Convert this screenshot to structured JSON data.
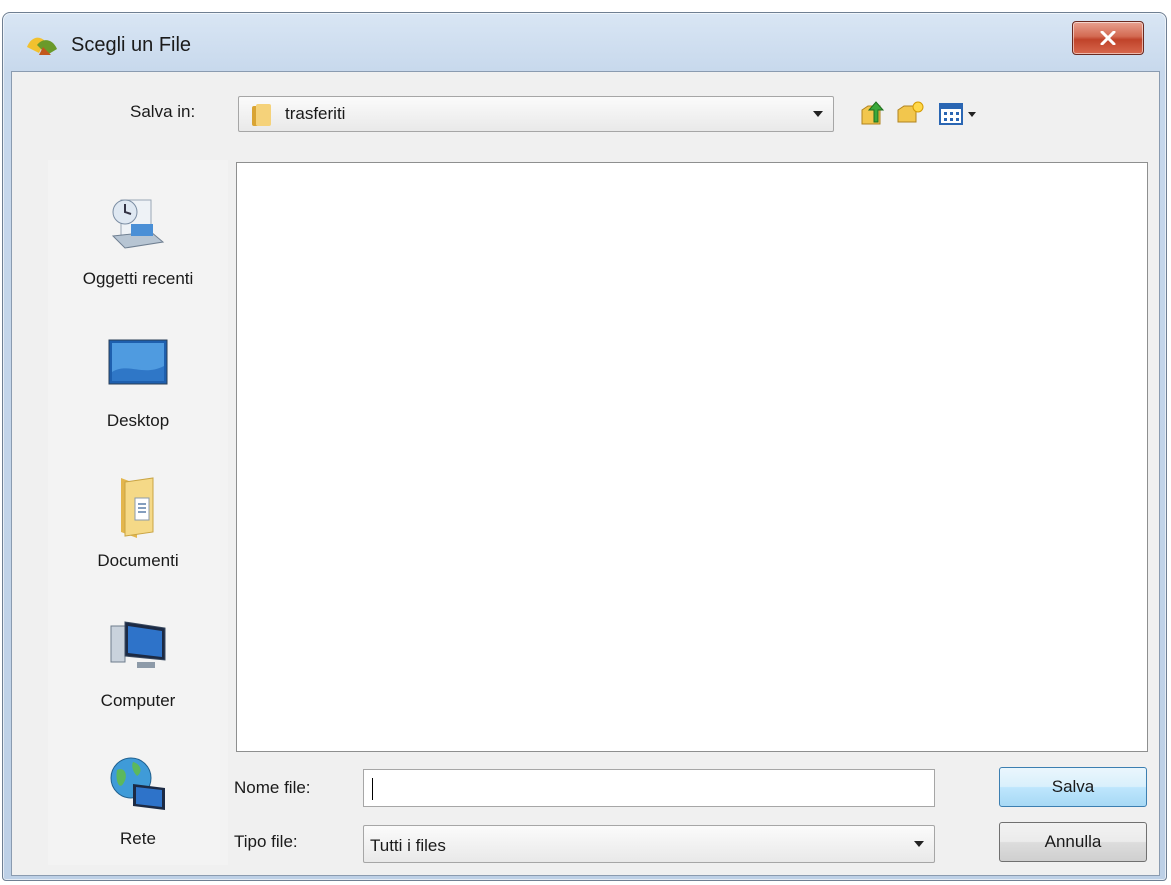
{
  "window": {
    "title": "Scegli un File"
  },
  "save_in": {
    "label": "Salva in:",
    "value": "trasferiti"
  },
  "places": [
    {
      "label": "Oggetti recenti",
      "icon": "recent-items-icon"
    },
    {
      "label": "Desktop",
      "icon": "desktop-icon"
    },
    {
      "label": "Documenti",
      "icon": "documents-folder-icon"
    },
    {
      "label": "Computer",
      "icon": "computer-icon"
    },
    {
      "label": "Rete",
      "icon": "network-icon"
    }
  ],
  "file_name": {
    "label": "Nome file:",
    "value": ""
  },
  "file_type": {
    "label": "Tipo file:",
    "value": "Tutti i files"
  },
  "buttons": {
    "save": "Salva",
    "cancel": "Annulla"
  },
  "toolbar": [
    "up-one-level-icon",
    "new-folder-icon",
    "view-menu-icon"
  ],
  "colors": {
    "accent": "#3c7fb1",
    "close": "#c0432a",
    "folder": "#e8b84a"
  }
}
